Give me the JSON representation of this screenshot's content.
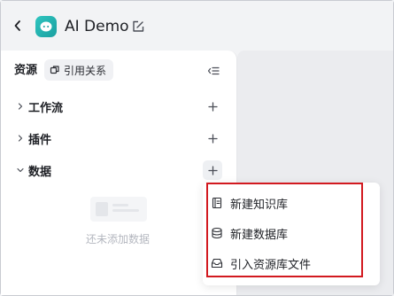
{
  "header": {
    "app_title": "AI Demo"
  },
  "sidebar": {
    "title": "资源",
    "reference_chip": "引用关系",
    "sections": [
      {
        "label": "工作流",
        "expanded": false
      },
      {
        "label": "插件",
        "expanded": false
      },
      {
        "label": "数据",
        "expanded": true
      }
    ],
    "empty_text": "还未添加数据"
  },
  "dropdown": {
    "items": [
      {
        "label": "新建知识库",
        "icon": "knowledge-base-icon"
      },
      {
        "label": "新建数据库",
        "icon": "database-icon"
      },
      {
        "label": "引入资源库文件",
        "icon": "import-library-icon"
      }
    ]
  },
  "colors": {
    "accent_teal": "#1fb3b0",
    "highlight_red": "#d2191f",
    "background": "#f2f3f5"
  }
}
